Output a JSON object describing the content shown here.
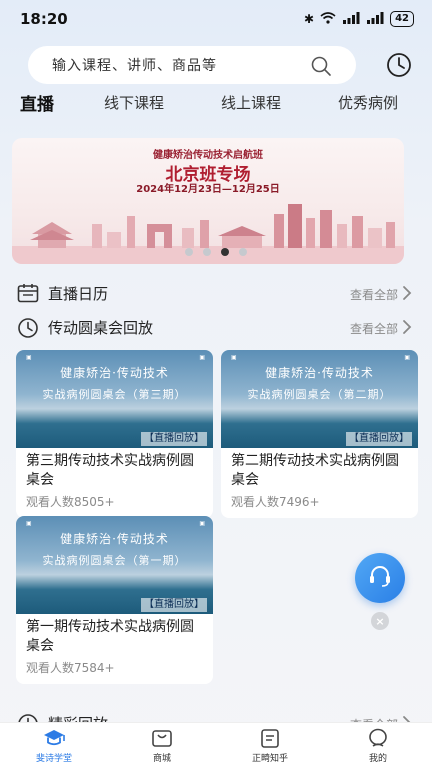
{
  "status_bar": {
    "time": "18:20",
    "battery": "42"
  },
  "search": {
    "placeholder": "输入课程、讲师、商品等"
  },
  "tabs": [
    {
      "label": "直播",
      "active": true
    },
    {
      "label": "线下课程",
      "active": false
    },
    {
      "label": "线上课程",
      "active": false
    },
    {
      "label": "优秀病例",
      "active": false
    }
  ],
  "banner": {
    "subtitle": "健康矫治传动技术启航班",
    "title": "北京班专场",
    "date": "2024年12月23日—12月25日",
    "page_count": 4,
    "active_index": 2
  },
  "sections": {
    "live_calendar": {
      "title": "直播日历",
      "more": "查看全部"
    },
    "roundtable": {
      "title": "传动圆桌会回放",
      "more": "查看全部"
    },
    "highlights": {
      "title": "精彩回放",
      "more": "查看全部"
    }
  },
  "cards": [
    {
      "thumb_line1": "健康矫治·传动技术",
      "thumb_line2": "实战病例圆桌会（第三期）",
      "tag": "【直播回放】",
      "title": "第三期传动技术实战病例圆桌会",
      "views": "观看人数8505+"
    },
    {
      "thumb_line1": "健康矫治·传动技术",
      "thumb_line2": "实战病例圆桌会（第二期）",
      "tag": "【直播回放】",
      "title": "第二期传动技术实战病例圆桌会",
      "views": "观看人数7496+"
    },
    {
      "thumb_line1": "健康矫治·传动技术",
      "thumb_line2": "实战病例圆桌会（第一期）",
      "tag": "【直播回放】",
      "title": "第一期传动技术实战病例圆桌会",
      "views": "观看人数7584+"
    }
  ],
  "bottom_nav": [
    {
      "label": "斐诗学堂",
      "icon": "graduation-cap-icon",
      "active": true
    },
    {
      "label": "商城",
      "icon": "shop-icon",
      "active": false
    },
    {
      "label": "正畸知乎",
      "icon": "document-icon",
      "active": false
    },
    {
      "label": "我的",
      "icon": "profile-icon",
      "active": false
    }
  ],
  "colors": {
    "accent": "#2c7be5",
    "banner_red": "#b01e30"
  }
}
